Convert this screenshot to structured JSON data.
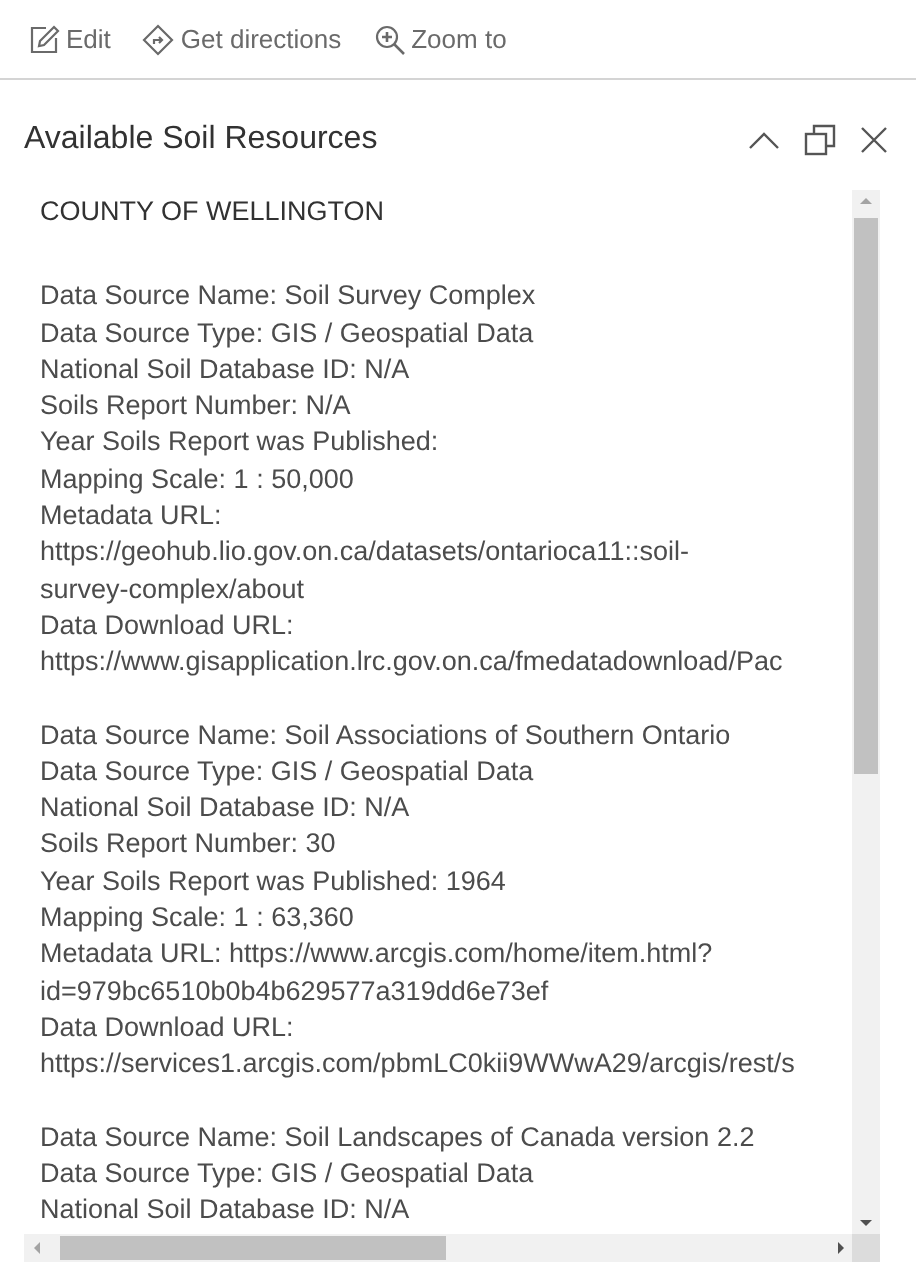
{
  "toolbar": [
    {
      "label": "Edit",
      "kind": "edit"
    },
    {
      "label": "Get directions",
      "kind": "directions"
    },
    {
      "label": "Zoom to",
      "kind": "zoom"
    }
  ],
  "panel": {
    "title": "Available Soil Resources"
  },
  "content": {
    "heading": "COUNTY OF WELLINGTON",
    "records": [
      {
        "lines": [
          "Data Source Name: Soil Survey Complex",
          "Data Source Type: GIS / Geospatial Data",
          "National Soil Database ID: N/A",
          "Soils Report Number: N/A",
          "Year Soils Report was Published:",
          "Mapping Scale: 1 : 50,000",
          "Metadata URL:",
          "https://geohub.lio.gov.on.ca/datasets/ontarioca11::soil-",
          "survey-complex/about",
          "Data Download URL:",
          "https://www.gisapplication.lrc.gov.on.ca/fmedatadownload/Pac"
        ]
      },
      {
        "lines": [
          "Data Source Name: Soil Associations of Southern Ontario",
          "Data Source Type: GIS / Geospatial Data",
          "National Soil Database ID: N/A",
          "Soils Report Number: 30",
          "Year Soils Report was Published: 1964",
          "Mapping Scale: 1 : 63,360",
          "Metadata URL: https://www.arcgis.com/home/item.html?",
          "id=979bc6510b0b4b629577a319dd6e73ef",
          "Data Download URL:",
          "https://services1.arcgis.com/pbmLC0kii9WWwA29/arcgis/rest/s"
        ]
      },
      {
        "lines": [
          "Data Source Name: Soil Landscapes of Canada version 2.2",
          "Data Source Type: GIS / Geospatial Data",
          "National Soil Database ID: N/A"
        ]
      }
    ]
  }
}
